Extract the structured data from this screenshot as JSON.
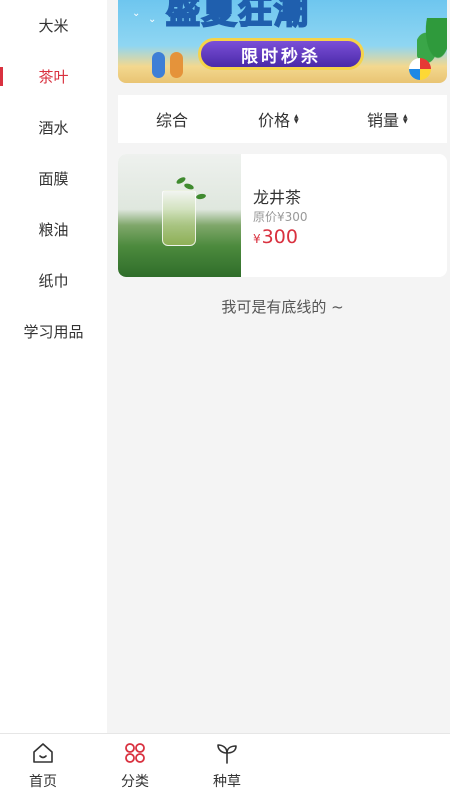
{
  "sidebar": {
    "items": [
      {
        "label": "大米",
        "active": false
      },
      {
        "label": "茶叶",
        "active": true
      },
      {
        "label": "酒水",
        "active": false
      },
      {
        "label": "面膜",
        "active": false
      },
      {
        "label": "粮油",
        "active": false
      },
      {
        "label": "纸巾",
        "active": false
      },
      {
        "label": "学习用品",
        "active": false
      }
    ]
  },
  "banner": {
    "title": "盛夏狂潮",
    "subtitle": "限时秒杀"
  },
  "sort": {
    "tabs": [
      {
        "label": "综合",
        "has_arrows": false
      },
      {
        "label": "价格",
        "has_arrows": true
      },
      {
        "label": "销量",
        "has_arrows": true
      }
    ]
  },
  "products": [
    {
      "name": "龙井茶",
      "original_price_label": "原价¥300",
      "currency": "¥",
      "price": "300"
    }
  ],
  "footer_note": "我可是有底线的 ~",
  "tabbar": {
    "items": [
      {
        "label": "首页",
        "icon": "home-icon",
        "active": false
      },
      {
        "label": "分类",
        "icon": "category-icon",
        "active": true
      },
      {
        "label": "种草",
        "icon": "sprout-icon",
        "active": false
      }
    ]
  },
  "colors": {
    "accent": "#d9313f",
    "background": "#f4f4f4"
  }
}
